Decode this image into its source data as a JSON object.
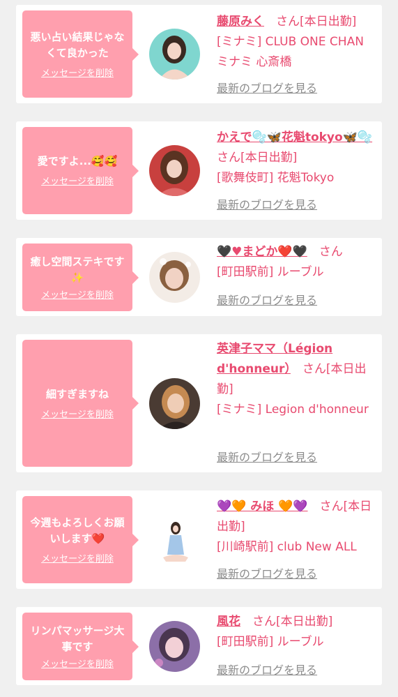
{
  "list": {
    "cards": [
      {
        "message": "悪い占い結果じゃなくて良かった",
        "delete_label": "メッセージを削除",
        "name": "藤原みく",
        "san": "　さん[本日出勤]",
        "shop": "[ミナミ] CLUB ONE CHAN ミナミ 心斎橋",
        "blog": "最新のブログを見る",
        "avatar_colors": [
          "#7fd6cf",
          "#f4d6c8",
          "#3a2a22"
        ]
      },
      {
        "message": "愛ですよ...🥰🥰",
        "delete_label": "メッセージを削除",
        "name": "かえで🫧🦋花魁tokyo🦋🫧",
        "san": "　さん[本日出勤]",
        "shop": "[歌舞伎町] 花魁Tokyo",
        "blog": "最新のブログを見る",
        "avatar_colors": [
          "#c8403e",
          "#f1d2c4",
          "#5a3322"
        ]
      },
      {
        "message": "癒し空間ステキです✨",
        "delete_label": "メッセージを削除",
        "name": "🖤♥まどか❤️🖤",
        "san": "　さん",
        "shop": "[町田駅前] ルーブル",
        "blog": "最新のブログを見る",
        "avatar_colors": [
          "#f3ece6",
          "#f1d2c4",
          "#8a6040"
        ]
      },
      {
        "message": "細すぎますね",
        "delete_label": "メッセージを削除",
        "name": "英津子ママ（Légion d'honneur）",
        "san": "　さん[本日出勤]",
        "shop": "[ミナミ] Legion d'honneur",
        "blog": "最新のブログを見る",
        "avatar_colors": [
          "#4a3b33",
          "#efcdb6",
          "#c58a52"
        ]
      },
      {
        "message": "今週もよろしくお願いします❤️",
        "delete_label": "メッセージを削除",
        "name": "💜🧡 みほ 🧡💜",
        "san": "　さん[本日出勤]",
        "shop": "[川崎駅前] club New ALL",
        "blog": "最新のブログを見る",
        "avatar_colors": [
          "#ffffff",
          "#f5d7c9",
          "#a4c6e8"
        ]
      },
      {
        "message": "リンパマッサージ大事です",
        "delete_label": "メッセージを削除",
        "name": "風花",
        "san": "　さん[本日出勤]",
        "shop": "[町田駅前] ルーブル",
        "blog": "最新のブログを見る",
        "avatar_colors": [
          "#8c6fa8",
          "#f2d0d6",
          "#4a3650"
        ]
      }
    ]
  }
}
